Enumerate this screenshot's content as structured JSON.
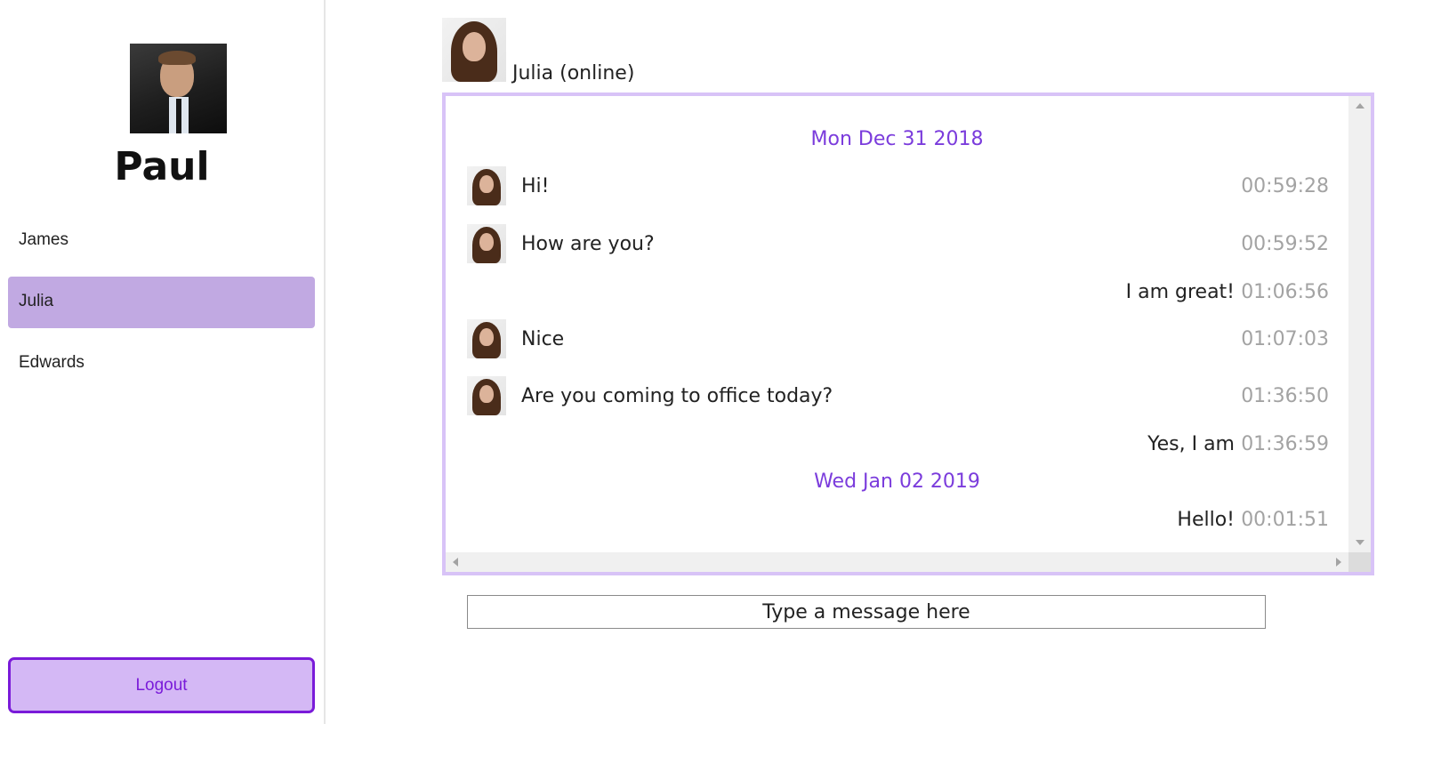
{
  "user": {
    "name": "Paul",
    "photo_icon": "profile-photo"
  },
  "contacts": [
    {
      "name": "James",
      "active": false
    },
    {
      "name": "Julia",
      "active": true
    },
    {
      "name": "Edwards",
      "active": false
    }
  ],
  "logout_label": "Logout",
  "chat": {
    "status": "Julia (online)",
    "date_1": "Mon Dec 31 2018",
    "date_2": "Wed Jan 02 2019",
    "messages": [
      {
        "from": "contact",
        "text": "Hi!",
        "time": "00:59:28"
      },
      {
        "from": "contact",
        "text": "How are you?",
        "time": "00:59:52"
      },
      {
        "from": "self",
        "text": "I am great!",
        "time": "01:06:56"
      },
      {
        "from": "contact",
        "text": "Nice",
        "time": "01:07:03"
      },
      {
        "from": "contact",
        "text": "Are you coming to office today?",
        "time": "01:36:50"
      },
      {
        "from": "self",
        "text": "Yes, I am",
        "time": "01:36:59"
      },
      {
        "from": "self",
        "text": "Hello!",
        "time": "00:01:51"
      }
    ]
  },
  "composer": {
    "placeholder": "Type a message here"
  },
  "colors": {
    "accent": "#7a1bd9",
    "active_contact": "#c1a9e2",
    "panel_border": "#d8c3f7",
    "date_text": "#7b3cdc",
    "timestamp": "#a3a3a3"
  }
}
